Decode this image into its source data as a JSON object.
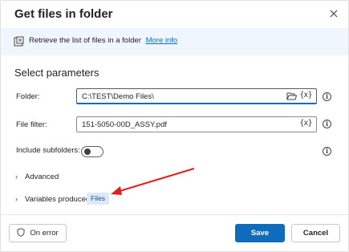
{
  "dialog": {
    "title": "Get files in folder",
    "close_icon": "close-icon"
  },
  "info": {
    "text": "Retrieve the list of files in a folder",
    "link": "More info",
    "icon": "file-list-icon"
  },
  "section_title": "Select parameters",
  "params": {
    "folder": {
      "label": "Folder:",
      "value": "C:\\TEST\\Demo Files\\",
      "var_button": "{x}"
    },
    "file_filter": {
      "label": "File filter:",
      "value": "151-5050-00D_ASSY.pdf",
      "var_button": "{x}"
    },
    "include_subfolders": {
      "label": "Include subfolders:",
      "state": "off"
    }
  },
  "advanced": {
    "label": "Advanced"
  },
  "variables": {
    "label": "Variables produced",
    "chip": "Files"
  },
  "footer": {
    "on_error": "On error",
    "save": "Save",
    "cancel": "Cancel"
  },
  "colors": {
    "accent": "#0f6cbd",
    "info_bg": "#f0f6fd",
    "chip_bg": "#dde9f7",
    "annotation_arrow": "#e02020"
  }
}
